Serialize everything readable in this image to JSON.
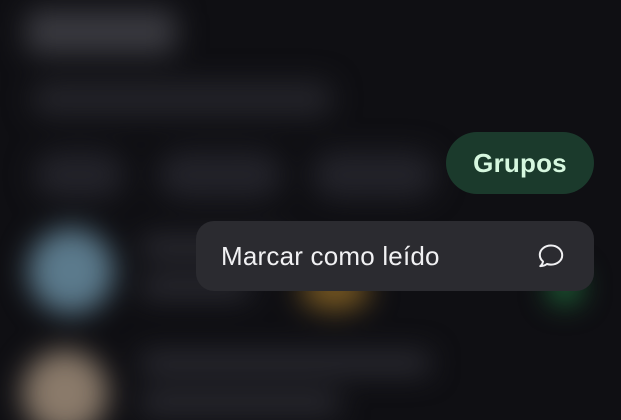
{
  "filter_chip": {
    "label": "Grupos",
    "icon": "none",
    "bg_color": "#1b3a2c",
    "text_color": "#d6f7df"
  },
  "context_menu": {
    "items": [
      {
        "label": "Marcar como leído",
        "icon": "chat-bubble-icon"
      }
    ]
  }
}
